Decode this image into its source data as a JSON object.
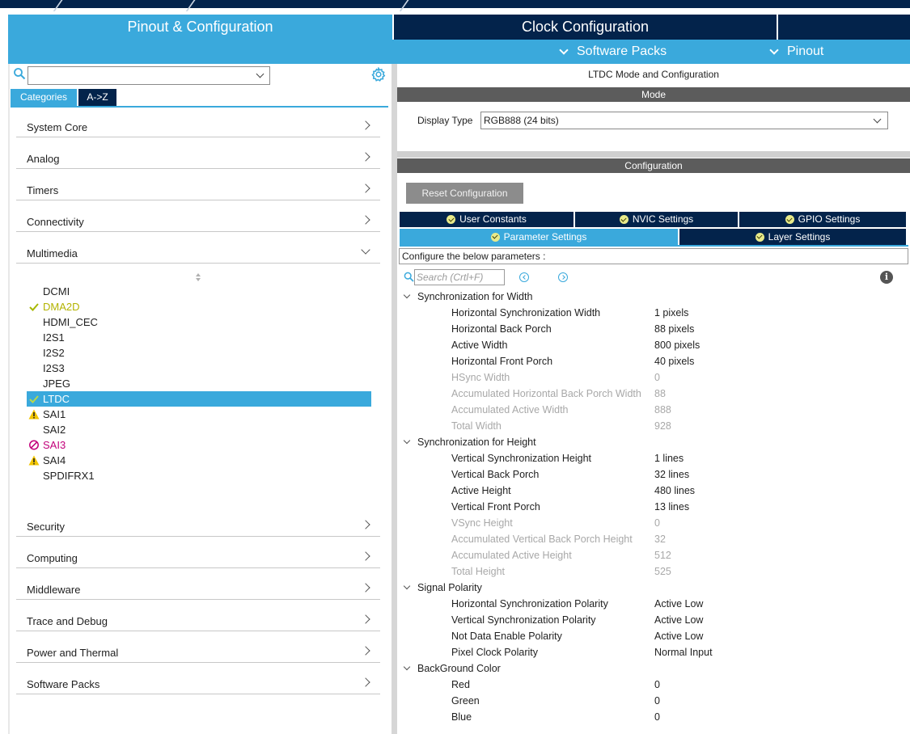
{
  "header": {
    "tabs": [
      "Pinout & Configuration",
      "Clock Configuration"
    ],
    "sub_items": [
      "Software Packs",
      "Pinout"
    ]
  },
  "left": {
    "tabs": [
      "Categories",
      "A->Z"
    ],
    "categories_top": [
      "System Core",
      "Analog",
      "Timers",
      "Connectivity",
      "Multimedia"
    ],
    "multimedia_items": [
      {
        "label": "DCMI",
        "status": "none"
      },
      {
        "label": "DMA2D",
        "status": "ok"
      },
      {
        "label": "HDMI_CEC",
        "status": "none"
      },
      {
        "label": "I2S1",
        "status": "none"
      },
      {
        "label": "I2S2",
        "status": "none"
      },
      {
        "label": "I2S3",
        "status": "none"
      },
      {
        "label": "JPEG",
        "status": "none"
      },
      {
        "label": "LTDC",
        "status": "ok"
      },
      {
        "label": "SAI1",
        "status": "warn"
      },
      {
        "label": "SAI2",
        "status": "none"
      },
      {
        "label": "SAI3",
        "status": "err"
      },
      {
        "label": "SAI4",
        "status": "warn"
      },
      {
        "label": "SPDIFRX1",
        "status": "none"
      }
    ],
    "categories_bottom": [
      "Security",
      "Computing",
      "Middleware",
      "Trace and Debug",
      "Power and Thermal",
      "Software Packs"
    ]
  },
  "right": {
    "title": "LTDC Mode and Configuration",
    "mode_header": "Mode",
    "display_type_label": "Display Type",
    "display_type_value": "RGB888 (24 bits)",
    "config_header": "Configuration",
    "reset_button": "Reset Configuration",
    "tabs_row1": [
      "User Constants",
      "NVIC Settings",
      "GPIO Settings"
    ],
    "tabs_row2": [
      "Parameter Settings",
      "Layer Settings"
    ],
    "configure_text": "Configure the below parameters :",
    "search_placeholder": "Search (Crtl+F)",
    "info_glyph": "i",
    "groups": [
      {
        "name": "Synchronization for Width",
        "params": [
          {
            "k": "Horizontal Synchronization Width",
            "v": "1 pixels",
            "dim": false
          },
          {
            "k": "Horizontal Back Porch",
            "v": "88 pixels",
            "dim": false
          },
          {
            "k": "Active Width",
            "v": "800 pixels",
            "dim": false
          },
          {
            "k": "Horizontal Front Porch",
            "v": "40 pixels",
            "dim": false
          },
          {
            "k": "HSync Width",
            "v": "0",
            "dim": true
          },
          {
            "k": "Accumulated Horizontal Back Porch Width",
            "v": "88",
            "dim": true
          },
          {
            "k": "Accumulated Active Width",
            "v": "888",
            "dim": true
          },
          {
            "k": "Total Width",
            "v": "928",
            "dim": true
          }
        ]
      },
      {
        "name": "Synchronization for Height",
        "params": [
          {
            "k": "Vertical Synchronization Height",
            "v": "1 lines",
            "dim": false
          },
          {
            "k": "Vertical Back Porch",
            "v": "32 lines",
            "dim": false
          },
          {
            "k": "Active Height",
            "v": "480 lines",
            "dim": false
          },
          {
            "k": "Vertical Front Porch",
            "v": "13 lines",
            "dim": false
          },
          {
            "k": "VSync Height",
            "v": "0",
            "dim": true
          },
          {
            "k": "Accumulated Vertical Back Porch Height",
            "v": "32",
            "dim": true
          },
          {
            "k": "Accumulated Active Height",
            "v": "512",
            "dim": true
          },
          {
            "k": "Total Height",
            "v": "525",
            "dim": true
          }
        ]
      },
      {
        "name": "Signal Polarity",
        "params": [
          {
            "k": "Horizontal Synchronization Polarity",
            "v": "Active Low",
            "dim": false
          },
          {
            "k": "Vertical Synchronization Polarity",
            "v": "Active Low",
            "dim": false
          },
          {
            "k": "Not Data Enable Polarity",
            "v": "Active Low",
            "dim": false
          },
          {
            "k": "Pixel Clock Polarity",
            "v": "Normal Input",
            "dim": false
          }
        ]
      },
      {
        "name": "BackGround Color",
        "params": [
          {
            "k": "Red",
            "v": "0",
            "dim": false
          },
          {
            "k": "Green",
            "v": "0",
            "dim": false
          },
          {
            "k": "Blue",
            "v": "0",
            "dim": false
          }
        ]
      }
    ]
  },
  "colors": {
    "accent": "#3aa9dc",
    "navy": "#03234b",
    "ok": "#b3b300",
    "warn": "#f2c500",
    "error": "#c2007a"
  }
}
